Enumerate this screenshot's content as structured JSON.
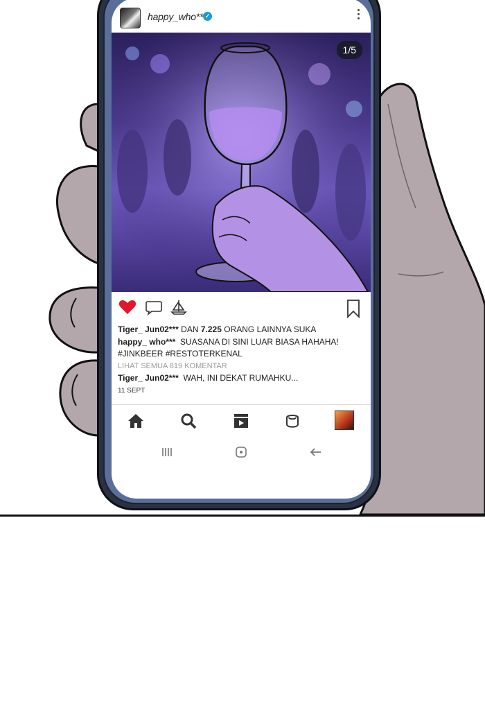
{
  "post": {
    "username": "happy_who***",
    "verified_mark": "✓",
    "image_counter": "1/5"
  },
  "likes": {
    "user": "Tiger_ Jun02***",
    "prefix": "DAN",
    "count": "7.225",
    "suffix": "ORANG LAINNYA SUKA"
  },
  "caption": {
    "user": "happy_ who***",
    "text": "SUASANA DI SINI LUAR BIASA HAHAHA!",
    "hashtags": "#JINKBEER #RESTOTERKENAL"
  },
  "comments": {
    "view_all": "LIHAT SEMUA 819 KOMENTAR",
    "user": "Tiger_ Jun02***",
    "text": "WAH, INI DEKAT RUMAHKU..."
  },
  "date": "11 SEPT",
  "icons": {
    "like": "heart-icon",
    "comment": "comment-icon",
    "share": "share-icon",
    "save": "bookmark-icon",
    "nav": [
      "home-icon",
      "search-icon",
      "reels-icon",
      "shop-icon",
      "profile-avatar"
    ],
    "system": [
      "recent-apps-icon",
      "home-button-icon",
      "back-icon"
    ]
  },
  "colors": {
    "like_red": "#e0182d",
    "verified_blue": "#1c9bd6",
    "phone_frame": "#5a6e9a"
  }
}
